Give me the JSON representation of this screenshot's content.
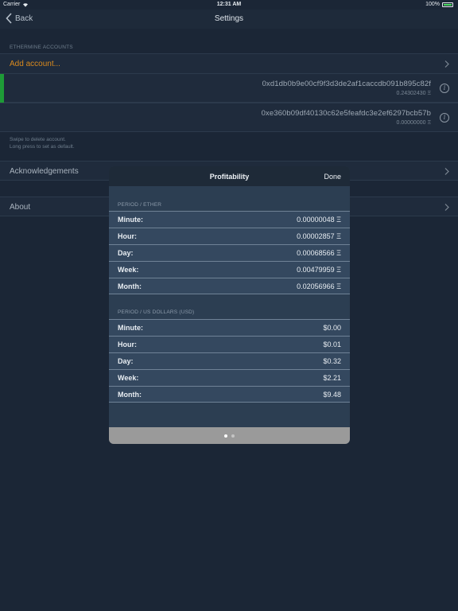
{
  "status_bar": {
    "carrier": "Carrier",
    "time": "12:31 AM",
    "battery": "100%"
  },
  "nav": {
    "back_label": "Back",
    "title": "Settings"
  },
  "accounts": {
    "header": "ETHERMINE ACCOUNTS",
    "add_label": "Add account...",
    "items": [
      {
        "address": "0xd1db0b9e00cf9f3d3de2af1caccdb091b895c82f",
        "balance": "0.24302430 Ξ",
        "default": true
      },
      {
        "address": "0xe360b09df40130c62e5feafdc3e2ef6297bcb57b",
        "balance": "0.00000000 Ξ",
        "default": false
      }
    ],
    "footnote_line1": "Swipe to delete account.",
    "footnote_line2": "Long press to set as default."
  },
  "menu": {
    "acknowledgements": "Acknowledgements",
    "about": "About"
  },
  "modal": {
    "title": "Profitability",
    "done_label": "Done",
    "ether_header": "PERIOD / ETHER",
    "ether_rows": [
      {
        "label": "Minute:",
        "value": "0.00000048 Ξ"
      },
      {
        "label": "Hour:",
        "value": "0.00002857 Ξ"
      },
      {
        "label": "Day:",
        "value": "0.00068566 Ξ"
      },
      {
        "label": "Week:",
        "value": "0.00479959 Ξ"
      },
      {
        "label": "Month:",
        "value": "0.02056966 Ξ"
      }
    ],
    "usd_header": "PERIOD / US DOLLARS (USD)",
    "usd_rows": [
      {
        "label": "Minute:",
        "value": "$0.00"
      },
      {
        "label": "Hour:",
        "value": "$0.01"
      },
      {
        "label": "Day:",
        "value": "$0.32"
      },
      {
        "label": "Week:",
        "value": "$2.21"
      },
      {
        "label": "Month:",
        "value": "$9.48"
      }
    ],
    "page_control": {
      "pages": 2,
      "current": 1
    }
  },
  "colors": {
    "accent_orange": "#d98a1e",
    "default_green": "#1e9b37",
    "battery_green": "#4cd964"
  }
}
